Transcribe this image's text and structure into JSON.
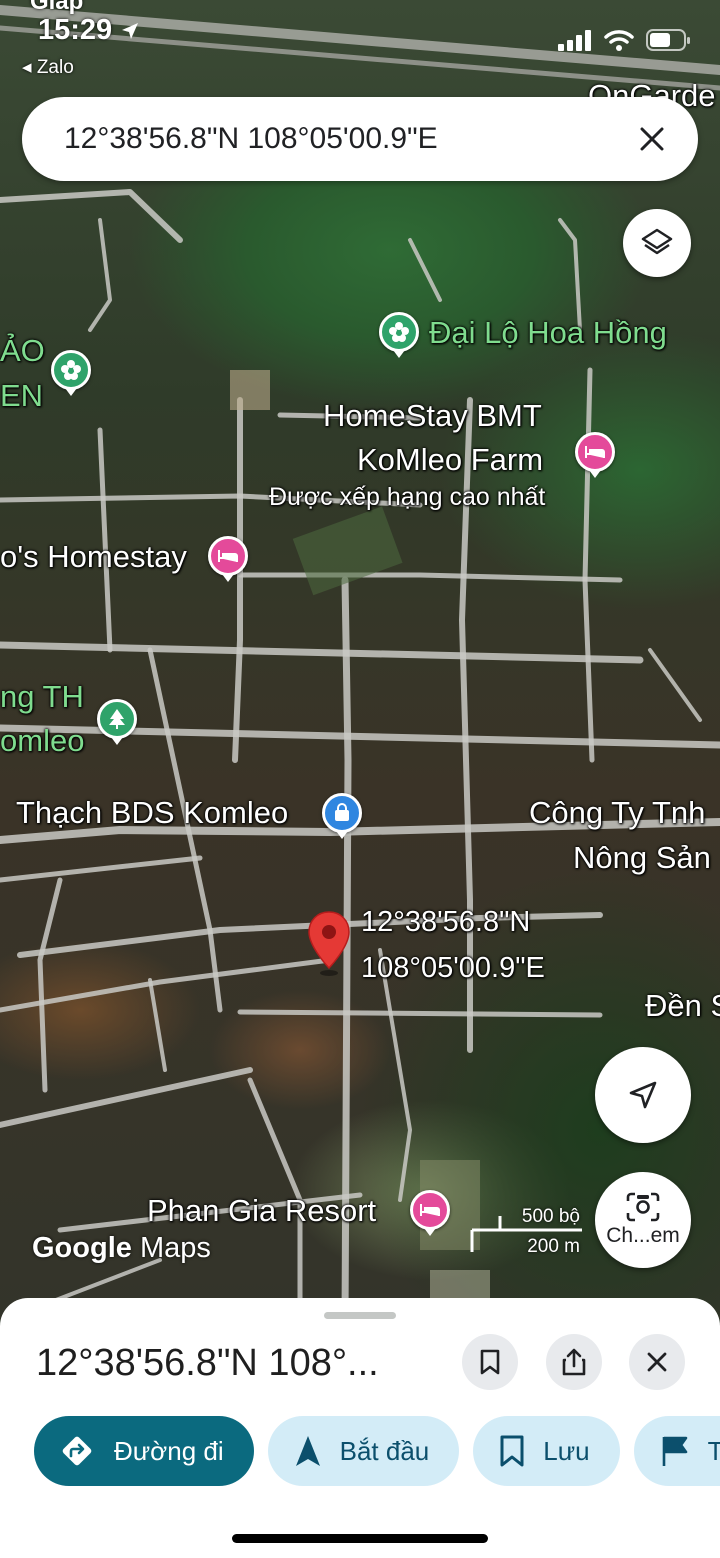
{
  "status_bar": {
    "time": "15:29",
    "back_label": "◂ Zalo",
    "top_partial_text": "Giáp"
  },
  "search": {
    "query": "12°38'56.8\"N 108°05'00.9\"E"
  },
  "map": {
    "labels": {
      "partial_top_right": "OnGarde",
      "dai_lo": "Đại Lộ Hoa Hồng",
      "left_partial_1": "ẢO",
      "left_partial_2": "EN",
      "homestay_1": "HomeStay BMT",
      "homestay_2": "KoMleo Farm",
      "homestay_rating": "Được xếp hạng cao nhất",
      "homestay_left": "o's Homestay",
      "th_1": "ng TH",
      "th_2": "omleo",
      "thach": "Thạch BDS Komleo",
      "cong_ty_1": "Công Ty Tnh",
      "cong_ty_2": "Nông Sản",
      "coord_1": "12°38'56.8\"N",
      "coord_2": "108°05'00.9\"E",
      "den": "Đền S",
      "phan_gia": "Phan Gia Resort"
    },
    "logo": {
      "google": "Google",
      "maps": "Maps"
    },
    "scale": {
      "imperial": "500 bộ",
      "metric": "200 m"
    },
    "lens_label": "Ch...em"
  },
  "sheet": {
    "title": "12°38'56.8\"N 108°...",
    "chips": [
      {
        "label": "Đường đi",
        "icon": "directions-icon"
      },
      {
        "label": "Bắt đầu",
        "icon": "navigation-arrow-icon"
      },
      {
        "label": "Lưu",
        "icon": "bookmark-icon"
      },
      {
        "label": "T",
        "icon": "flag-icon"
      }
    ]
  },
  "colors": {
    "primary_chip": "#0b6a7f",
    "chip_bg": "#d3ecf7",
    "pin_red": "#e53935",
    "poi_pink": "#e44a9a",
    "poi_green": "#2fa36a",
    "poi_blue": "#2f86e0"
  }
}
